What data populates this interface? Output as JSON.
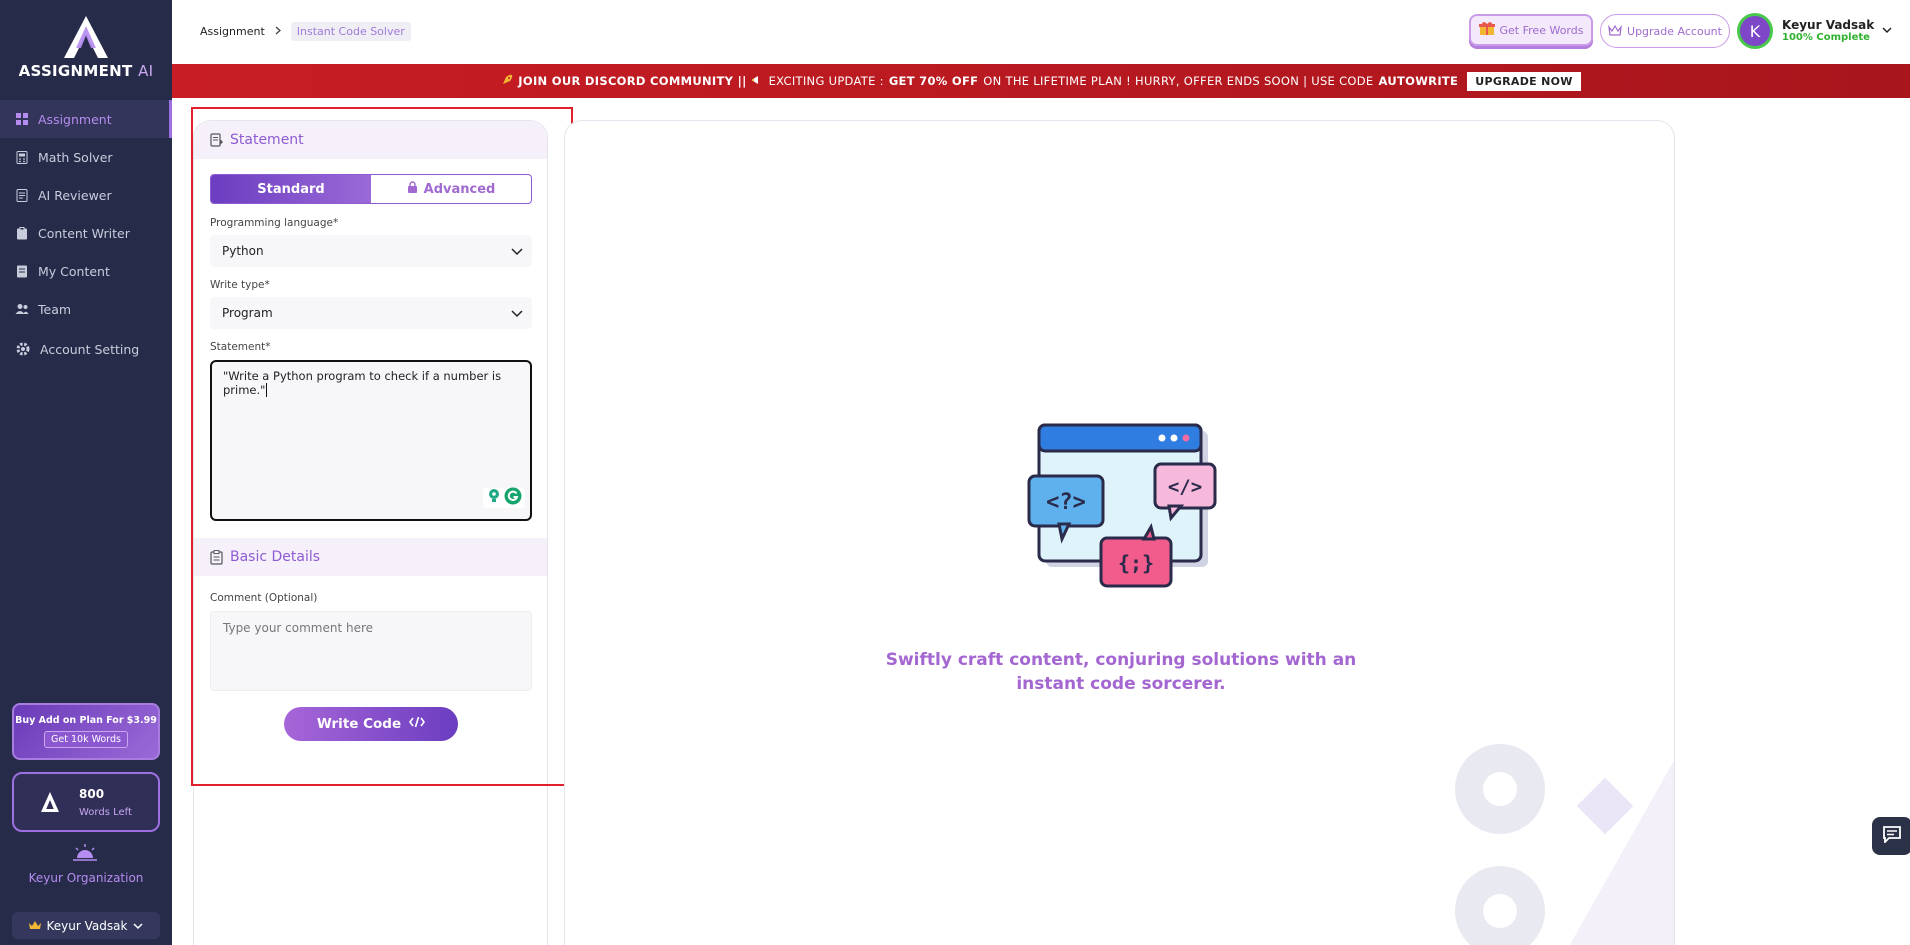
{
  "app": {
    "logo_text": "ASSIGNMENT",
    "logo_suffix": "AI"
  },
  "sidebar": {
    "items": [
      {
        "label": "Assignment",
        "icon": "grid-icon",
        "active": true
      },
      {
        "label": "Math Solver",
        "icon": "calculator-icon",
        "active": false
      },
      {
        "label": "AI Reviewer",
        "icon": "document-icon",
        "active": false
      },
      {
        "label": "Content Writer",
        "icon": "clipboard-icon",
        "active": false
      },
      {
        "label": "My Content",
        "icon": "file-icon",
        "active": false
      },
      {
        "label": "Team",
        "icon": "users-icon",
        "active": false
      },
      {
        "label": "Account Setting",
        "icon": "gear-icon",
        "active": false
      }
    ],
    "promo": {
      "text": "Buy Add on Plan For $3.99",
      "button": "Get 10k Words"
    },
    "words": {
      "count": "800",
      "label": "Words Left"
    },
    "org_name": "Keyur Organization",
    "user_name": "Keyur Vadsak"
  },
  "header": {
    "breadcrumb": [
      "Assignment",
      "Instant Code Solver"
    ],
    "free_words_label": "Get Free Words",
    "upgrade_label": "Upgrade Account",
    "avatar_letter": "K",
    "user_name": "Keyur Vadsak",
    "user_status": "100% Complete"
  },
  "banner": {
    "part1": "JOIN OUR DISCORD COMMUNITY ||",
    "part2": "EXCITING UPDATE :",
    "part3": "GET 70% OFF",
    "part4": "ON THE LIFETIME PLAN ! HURRY, OFFER ENDS SOON | USE CODE",
    "code": "AUTOWRITE",
    "button": "UPGRADE NOW"
  },
  "form": {
    "statement_section": "Statement",
    "tabs": [
      "Standard",
      "Advanced"
    ],
    "language_label": "Programming language*",
    "language_value": "Python",
    "write_type_label": "Write type*",
    "write_type_value": "Program",
    "statement_label": "Statement*",
    "statement_value": "\"Write a Python program to check if a number is prime.\"",
    "basic_section": "Basic Details",
    "comment_label": "Comment (Optional)",
    "comment_placeholder": "Type your comment here",
    "submit_label": "Write Code"
  },
  "result": {
    "caption_line1": "Swiftly craft content, conjuring solutions with an",
    "caption_line2": "instant code sorcerer.",
    "illustration_tokens": [
      "<?>",
      "</>",
      "{;}"
    ]
  },
  "colors": {
    "sidebar_bg": "#272b4a",
    "accent": "#8e5bd2",
    "banner_red": "#c81d24",
    "status_green": "#2fb12f"
  }
}
